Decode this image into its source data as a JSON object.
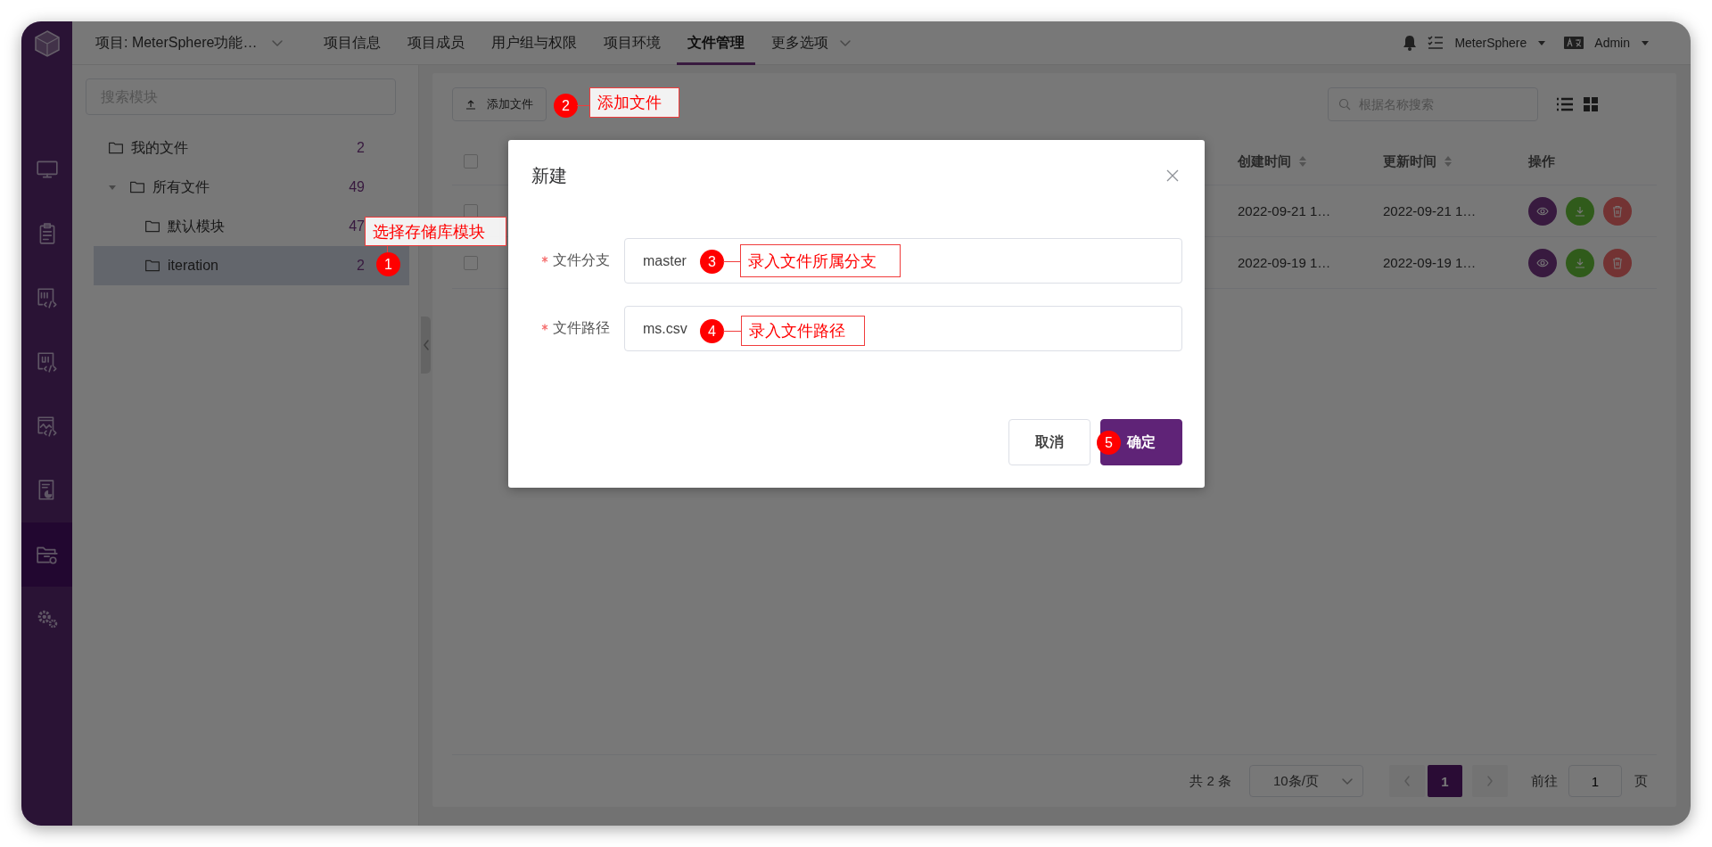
{
  "nav_rail": {
    "items": [
      {
        "kind": "monitor",
        "selected": false
      },
      {
        "kind": "clipboard",
        "selected": false
      },
      {
        "kind": "api",
        "selected": false
      },
      {
        "kind": "ui",
        "selected": false
      },
      {
        "kind": "performance",
        "selected": false
      },
      {
        "kind": "report",
        "selected": false
      },
      {
        "kind": "files",
        "selected": true
      },
      {
        "kind": "settings",
        "selected": false
      }
    ]
  },
  "top_bar": {
    "project": "项目: MeterSphere功能…",
    "tabs": [
      {
        "label": "项目信息",
        "selected": false,
        "dropdown": false
      },
      {
        "label": "项目成员",
        "selected": false,
        "dropdown": false
      },
      {
        "label": "用户组与权限",
        "selected": false,
        "dropdown": false
      },
      {
        "label": "项目环境",
        "selected": false,
        "dropdown": false
      },
      {
        "label": "文件管理",
        "selected": true,
        "dropdown": false
      },
      {
        "label": "更多选项",
        "selected": false,
        "dropdown": true
      }
    ],
    "workspace": "MeterSphere",
    "user": "Admin"
  },
  "module_tree": {
    "search": {
      "placeholder": "搜索模块"
    },
    "items": [
      {
        "label": "我的文件",
        "count": "2",
        "selected": false
      },
      {
        "label": "所有文件",
        "count": "49",
        "selected": false,
        "expanded": true,
        "children": [
          {
            "label": "默认模块",
            "count": "47",
            "selected": false
          },
          {
            "label": "iteration",
            "count": "2",
            "selected": true
          }
        ]
      }
    ]
  },
  "file_list": {
    "add_button": "添加文件",
    "search": {
      "placeholder": "根据名称搜索"
    },
    "view_modes": [
      {
        "kind": "list"
      },
      {
        "kind": "grid"
      }
    ],
    "table": {
      "header_checked": false,
      "columns": [
        {
          "label": "创建时间",
          "sortable": true
        },
        {
          "label": "更新时间",
          "sortable": true
        },
        {
          "label": "操作",
          "sortable": false
        }
      ],
      "rows": [
        {
          "checked": false,
          "created": "2022-09-21 1…",
          "updated": "2022-09-21 1…",
          "actions": [
            {
              "kind": "view"
            },
            {
              "kind": "download"
            },
            {
              "kind": "delete"
            }
          ]
        },
        {
          "checked": false,
          "created": "2022-09-19 1…",
          "updated": "2022-09-19 1…",
          "actions": [
            {
              "kind": "view"
            },
            {
              "kind": "download"
            },
            {
              "kind": "delete"
            }
          ]
        }
      ]
    },
    "pagination": {
      "total": "共 2 条",
      "page_size": "10条/页",
      "pages": [
        {
          "label": "1",
          "selected": true
        }
      ],
      "goto_label": "前往",
      "goto_value": "1",
      "page_suffix": "页"
    }
  },
  "dialog": {
    "title": "新建",
    "fields": [
      {
        "label": "文件分支",
        "required": true,
        "value": "master"
      },
      {
        "label": "文件路径",
        "required": true,
        "value": "ms.csv"
      }
    ],
    "buttons": [
      {
        "label": "取消",
        "kind": "secondary"
      },
      {
        "label": "确定",
        "kind": "primary"
      }
    ]
  },
  "annotations": [
    {
      "number": "1",
      "text": "选择存储库模块"
    },
    {
      "number": "2",
      "text": "添加文件"
    },
    {
      "number": "3",
      "text": "录入文件所属分支"
    },
    {
      "number": "4",
      "text": "录入文件路径"
    },
    {
      "number": "5"
    }
  ]
}
